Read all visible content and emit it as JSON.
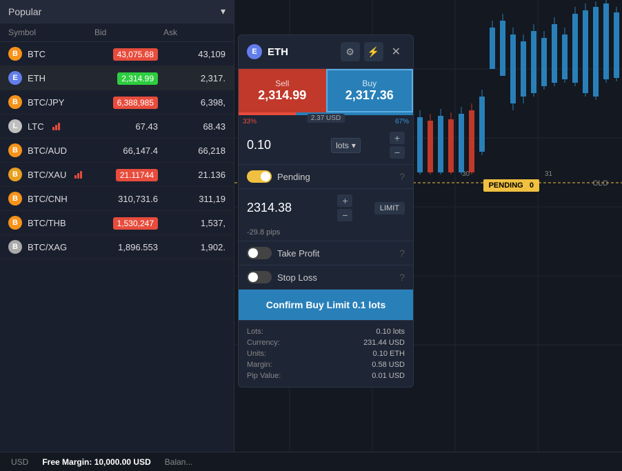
{
  "header": {
    "dropdown_label": "Popular",
    "dropdown_icon": "▾"
  },
  "table": {
    "columns": [
      "Symbol",
      "Bid",
      "Ask"
    ],
    "rows": [
      {
        "symbol": "BTC",
        "icon": "B",
        "icon_class": "icon-btc",
        "bid": "43,075.68",
        "ask": "43,109",
        "bid_type": "red",
        "ask_type": "plain",
        "signals": 0
      },
      {
        "symbol": "ETH",
        "icon": "E",
        "icon_class": "icon-eth",
        "bid": "2,314.99",
        "ask": "2,317.",
        "bid_type": "green",
        "ask_type": "plain",
        "signals": 0
      },
      {
        "symbol": "BTC/JPY",
        "icon": "B",
        "icon_class": "icon-btcjpy",
        "bid": "6,388,985",
        "ask": "6,398,",
        "bid_type": "red",
        "ask_type": "plain",
        "signals": 0
      },
      {
        "symbol": "LTC",
        "icon": "L",
        "icon_class": "icon-ltc",
        "bid": "67.43",
        "ask": "68.43",
        "bid_type": "plain",
        "ask_type": "plain",
        "signals": 3
      },
      {
        "symbol": "BTC/AUD",
        "icon": "B",
        "icon_class": "icon-btcaud",
        "bid": "66,147.4",
        "ask": "66,218",
        "bid_type": "plain",
        "ask_type": "plain",
        "signals": 0
      },
      {
        "symbol": "BTC/XAU",
        "icon": "B",
        "icon_class": "icon-btcxau",
        "bid": "21.11744",
        "ask": "21.136",
        "bid_type": "red",
        "ask_type": "plain",
        "signals": 3
      },
      {
        "symbol": "BTC/CNH",
        "icon": "B",
        "icon_class": "icon-btccnh",
        "bid": "310,731.6",
        "ask": "311,19",
        "bid_type": "plain",
        "ask_type": "plain",
        "signals": 0
      },
      {
        "symbol": "BTC/THB",
        "icon": "B",
        "icon_class": "icon-btcthb",
        "bid": "1,530,247",
        "ask": "1,537,",
        "bid_type": "red",
        "ask_type": "plain",
        "signals": 0
      },
      {
        "symbol": "BTC/XAG",
        "icon": "B",
        "icon_class": "icon-btcxag",
        "bid": "1,896.553",
        "ask": "1,902.",
        "bid_type": "plain",
        "ask_type": "plain",
        "signals": 0
      }
    ]
  },
  "trade_panel": {
    "title": "ETH",
    "eth_letter": "E",
    "sell_label": "Sell",
    "sell_price": "2,314.99",
    "buy_label": "Buy",
    "buy_price": "2,317.36",
    "spread": "2.37 USD",
    "spread_left_pct": "33%",
    "spread_right_pct": "67%",
    "lots_value": "0.10",
    "lots_unit": "lots",
    "lots_unit_arrow": "▾",
    "pending_label": "Pending",
    "pending_help": "?",
    "limit_price": "2314.38",
    "limit_badge": "LIMIT",
    "pips": "-29.8 pips",
    "take_profit_label": "Take Profit",
    "take_profit_help": "?",
    "stop_loss_label": "Stop Loss",
    "stop_loss_help": "?",
    "confirm_btn_label": "Confirm Buy Limit 0.1 lots",
    "summary": {
      "lots_label": "Lots:",
      "lots_value": "0.10 lots",
      "currency_label": "Currency:",
      "currency_value": "231.44 USD",
      "units_label": "Units:",
      "units_value": "0.10 ETH",
      "margin_label": "Margin:",
      "margin_value": "0.58 USD",
      "pip_label": "Pip Value:",
      "pip_value": "0.01 USD"
    }
  },
  "chart": {
    "pending_label": "PENDING",
    "pending_count": "0",
    "clo_label": "CLO"
  },
  "status_bar": {
    "usd_label": "USD",
    "free_margin_label": "Free Margin:",
    "free_margin_value": "10,000.00 USD",
    "balance_label": "Balan..."
  }
}
